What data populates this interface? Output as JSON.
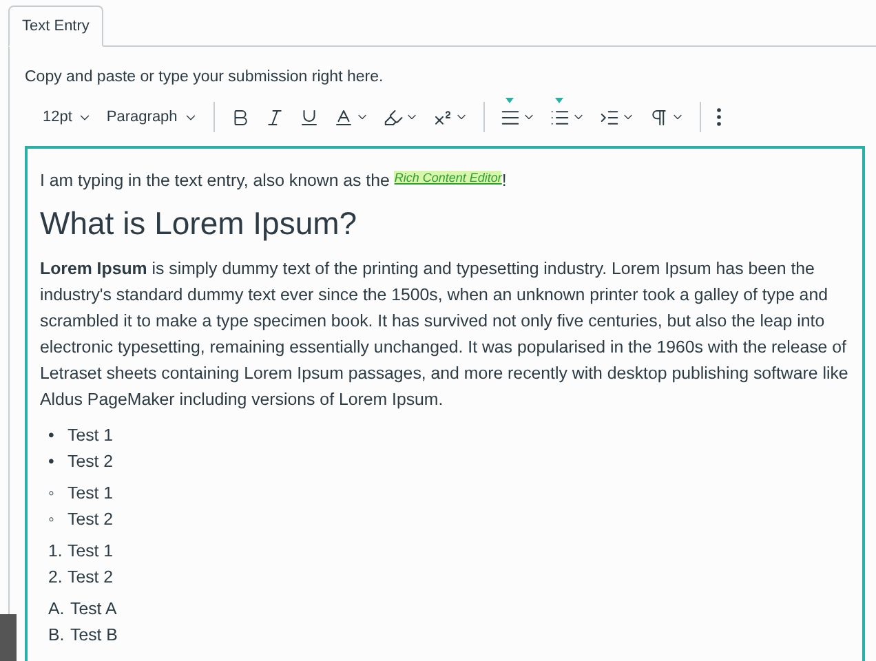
{
  "tabs": [
    {
      "label": "Text Entry",
      "selected": true
    }
  ],
  "instruction": "Copy and paste or type your submission right here.",
  "toolbar": {
    "font_size": "12pt",
    "block_format": "Paragraph",
    "buttons": [
      {
        "kind": "bold",
        "dropdown": false,
        "indicator": false
      },
      {
        "kind": "italic",
        "dropdown": false,
        "indicator": false
      },
      {
        "kind": "underline",
        "dropdown": false,
        "indicator": false
      },
      {
        "kind": "text-color",
        "dropdown": true,
        "indicator": false
      },
      {
        "kind": "highlight",
        "dropdown": true,
        "indicator": false
      },
      {
        "kind": "superscript",
        "dropdown": true,
        "indicator": false
      },
      {
        "kind": "divider"
      },
      {
        "kind": "align",
        "dropdown": true,
        "indicator": true
      },
      {
        "kind": "list",
        "dropdown": true,
        "indicator": true
      },
      {
        "kind": "indent",
        "dropdown": true,
        "indicator": false
      },
      {
        "kind": "direction",
        "dropdown": true,
        "indicator": false
      },
      {
        "kind": "divider"
      },
      {
        "kind": "more",
        "dropdown": false,
        "indicator": false
      }
    ]
  },
  "editor": {
    "intro": {
      "before": "I am typing in the text entry, also known as the ",
      "link": "Rich Content Editor",
      "after": "!"
    },
    "heading": "What is Lorem Ipsum?",
    "paragraph": "**Lorem Ipsum** is simply dummy text of the printing and typesetting industry. Lorem Ipsum has been the industry's standard dummy text ever since the 1500s, when an unknown printer took a galley of type and scrambled it to make a type specimen book. It has survived not only five centuries, but also the leap into electronic typesetting, remaining essentially unchanged. It was popularised in the 1960s with the release of Letraset sheets containing Lorem Ipsum passages, and more recently with desktop publishing software like Aldus PageMaker including versions of Lorem Ipsum.",
    "lists": [
      {
        "kind": "bullet",
        "items": [
          {
            "marker": "•",
            "text": "Test 1"
          },
          {
            "marker": "•",
            "text": "Test 2"
          }
        ]
      },
      {
        "kind": "circle",
        "items": [
          {
            "marker": "◦",
            "text": "Test 1"
          },
          {
            "marker": "◦",
            "text": "Test 2"
          }
        ]
      },
      {
        "kind": "number",
        "items": [
          {
            "marker": "1.",
            "text": "Test 1"
          },
          {
            "marker": "2.",
            "text": "Test 2"
          }
        ]
      },
      {
        "kind": "alpha",
        "items": [
          {
            "marker": "A.",
            "text": "Test A"
          },
          {
            "marker": "B.",
            "text": "Test B"
          }
        ]
      }
    ]
  }
}
